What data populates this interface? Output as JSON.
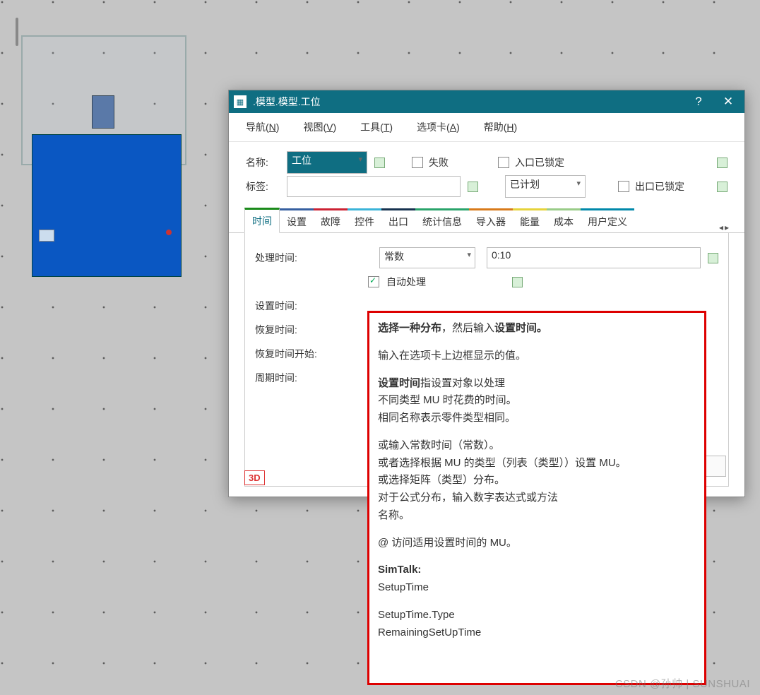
{
  "window": {
    "title": ".模型.模型.工位"
  },
  "menu": {
    "nav": "导航(N)",
    "view": "视图(V)",
    "tools": "工具(T)",
    "tabs": "选项卡(A)",
    "help": "帮助(H)"
  },
  "form": {
    "name_label": "名称:",
    "name_value": "工位",
    "tag_label": "标签:",
    "tag_value": "",
    "fail": "失败",
    "entry_locked": "入口已锁定",
    "planned": "已计划",
    "exit_locked": "出口已锁定"
  },
  "tabs": {
    "time": "时间",
    "setup": "设置",
    "fault": "故障",
    "ctrl": "控件",
    "exit": "出口",
    "stats": "统计信息",
    "importer": "导入器",
    "energy": "能量",
    "cost": "成本",
    "user": "用户定义",
    "nav_left": "◂",
    "nav_right": "▸"
  },
  "time_tab": {
    "proc_label": "处理时间:",
    "proc_type": "常数",
    "proc_value": "0:10",
    "auto": "自动处理",
    "setup_label": "设置时间:",
    "recover_label": "恢复时间:",
    "recover_start_label": "恢复时间开始:",
    "cycle_label": "周期时间:"
  },
  "help": {
    "l1a": "选择一种分布",
    "l1b": "，然后输入",
    "l1c": "设置时间。",
    "l2": "输入在选项卡上边框显示的值。",
    "l3a": "设置时间",
    "l3b": "指设置对象以处理",
    "l4": "不同类型 MU 时花费的时间。",
    "l5": "相同名称表示零件类型相同。",
    "l6": "或输入常数时间（常数）。",
    "l7": "或者选择根据 MU 的类型（列表（类型））设置 MU。",
    "l8": "或选择矩阵（类型）分布。",
    "l9": "对于公式分布，输入数字表达式或方法",
    "l10": "名称。",
    "l11": "@ 访问适用设置时间的 MU。",
    "st_h": "SimTalk:",
    "st_1": "SetupTime",
    "st_2": "SetupTime.Type",
    "st_3": "RemainingSetUpTime"
  },
  "footer": {
    "threeD": "3D"
  },
  "watermark": "CSDN @孙帅 | SUNSHUAI"
}
